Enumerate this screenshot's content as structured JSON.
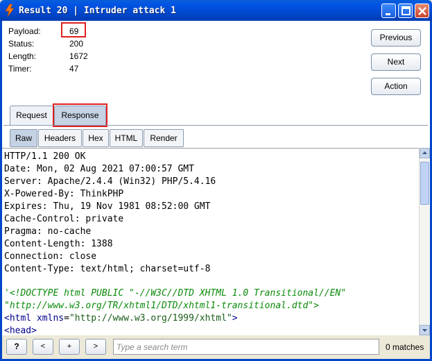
{
  "window": {
    "title": "Result 20 | Intruder attack 1"
  },
  "info": {
    "payload_label": "Payload:",
    "payload_value": "69",
    "status_label": "Status:",
    "status_value": "200",
    "length_label": "Length:",
    "length_value": "1672",
    "timer_label": "Timer:",
    "timer_value": "47"
  },
  "buttons": {
    "previous": "Previous",
    "next": "Next",
    "action": "Action"
  },
  "outer_tabs": [
    {
      "label": "Request",
      "active": false
    },
    {
      "label": "Response",
      "active": true
    }
  ],
  "inner_tabs": [
    {
      "label": "Raw",
      "active": true
    },
    {
      "label": "Headers",
      "active": false
    },
    {
      "label": "Hex",
      "active": false
    },
    {
      "label": "HTML",
      "active": false
    },
    {
      "label": "Render",
      "active": false
    }
  ],
  "response_lines": [
    "HTTP/1.1 200 OK",
    "Date: Mon, 02 Aug 2021 07:00:57 GMT",
    "Server: Apache/2.4.4 (Win32) PHP/5.4.16",
    "X-Powered-By: ThinkPHP",
    "Expires: Thu, 19 Nov 1981 08:52:00 GMT",
    "Cache-Control: private",
    "Pragma: no-cache",
    "Content-Length: 1388",
    "Connection: close",
    "Content-Type: text/html; charset=utf-8"
  ],
  "body_lines": {
    "doctype_1": "'<!DOCTYPE html PUBLIC \"-//W3C//DTD XHTML 1.0 Transitional//EN\"",
    "doctype_2": "\"http://www.w3.org/TR/xhtml1/DTD/xhtml1-transitional.dtd\">",
    "html_open": "<",
    "html_tag": "html",
    "html_attr": " xmlns",
    "html_eq": "=",
    "html_val": "\"http://www.w3.org/1999/xhtml\"",
    "html_close": ">",
    "head_open": "<",
    "head_tag": "head",
    "head_close": ">"
  },
  "bottom": {
    "help": "?",
    "prev": "<",
    "add": "+",
    "next": ">",
    "search_placeholder": "Type a search term",
    "matches": "0 matches"
  },
  "colors": {
    "titlebar": "#0055e5",
    "highlight": "#e02020",
    "doctype_green": "#0a8a0a",
    "tag_navy": "#00008b"
  }
}
